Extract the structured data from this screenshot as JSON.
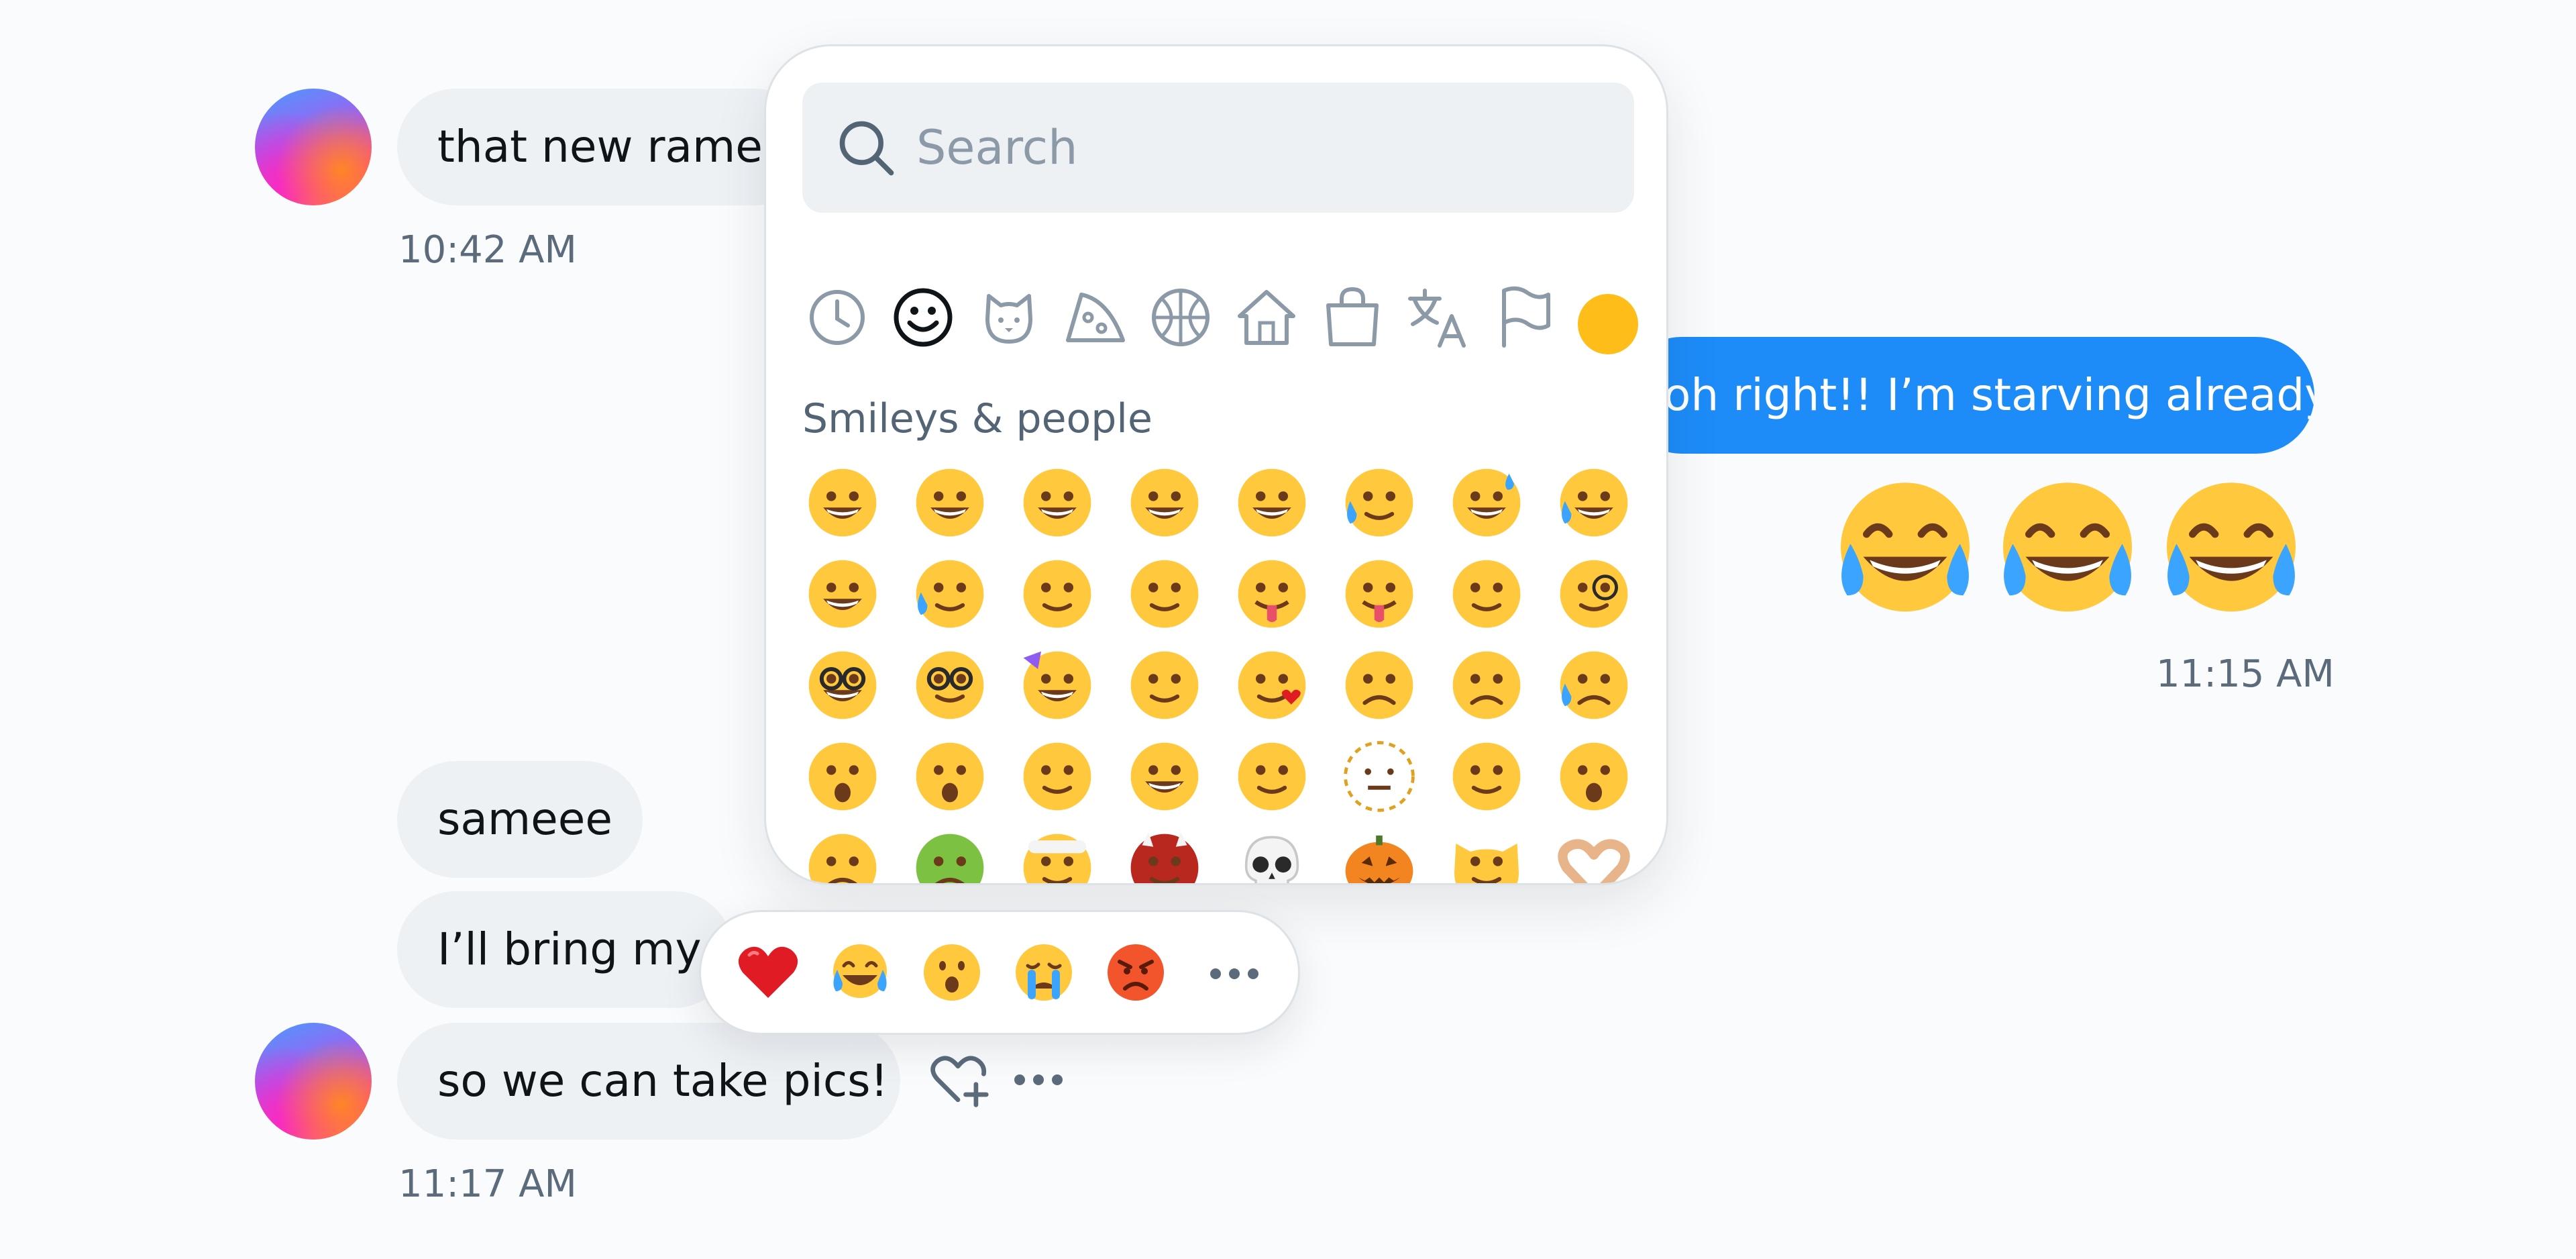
{
  "conversation": {
    "messages": [
      {
        "text": "that new ramen",
        "time": "10:42 AM"
      },
      {
        "text": "oh right!! I’m starving already",
        "emoji_reaction": "😂😂😂",
        "time": "11:15 AM"
      },
      {
        "text": "sameee"
      },
      {
        "text": "I’ll bring my f"
      },
      {
        "text": "so we can take pics!",
        "time": "11:17 AM"
      }
    ]
  },
  "emoji_picker": {
    "search_placeholder": "Search",
    "categories": [
      "recent-icon",
      "smiley-icon",
      "animal-icon",
      "food-icon",
      "activity-icon",
      "travel-icon",
      "objects-icon",
      "symbols-icon",
      "flag-icon",
      "skin-tone-icon"
    ],
    "section_title": "Smileys & people",
    "emojis": [
      "grinning",
      "smiley",
      "smile",
      "grin",
      "laughing",
      "holding-back-tears",
      "sweat-smile",
      "joy",
      "rofl",
      "face-holding-tears",
      "relaxed",
      "kissing-closed-eyes",
      "tongue-out",
      "winking-tongue",
      "upside-down",
      "monocle",
      "nerd",
      "disguise",
      "party",
      "unamused",
      "kissing-heart",
      "worried",
      "confounded",
      "crying",
      "exploding-head",
      "screaming",
      "thinking",
      "hugging",
      "saluting",
      "dotted-line",
      "eye-roll",
      "hushed",
      "sighing",
      "nauseated",
      "bandage",
      "ogre",
      "skull",
      "jack-o-lantern",
      "smirk-cat",
      "heart-hands"
    ],
    "skin_tone_color": "#ffbd1a"
  },
  "reaction_bar": {
    "reactions": [
      "heart",
      "joy",
      "wow",
      "sob",
      "angry"
    ],
    "more_label": "more"
  },
  "colors": {
    "outgoing_bubble": "#1d8cf8",
    "incoming_bubble": "#eef1f4",
    "emoji_yellow": "#ffc83d"
  }
}
